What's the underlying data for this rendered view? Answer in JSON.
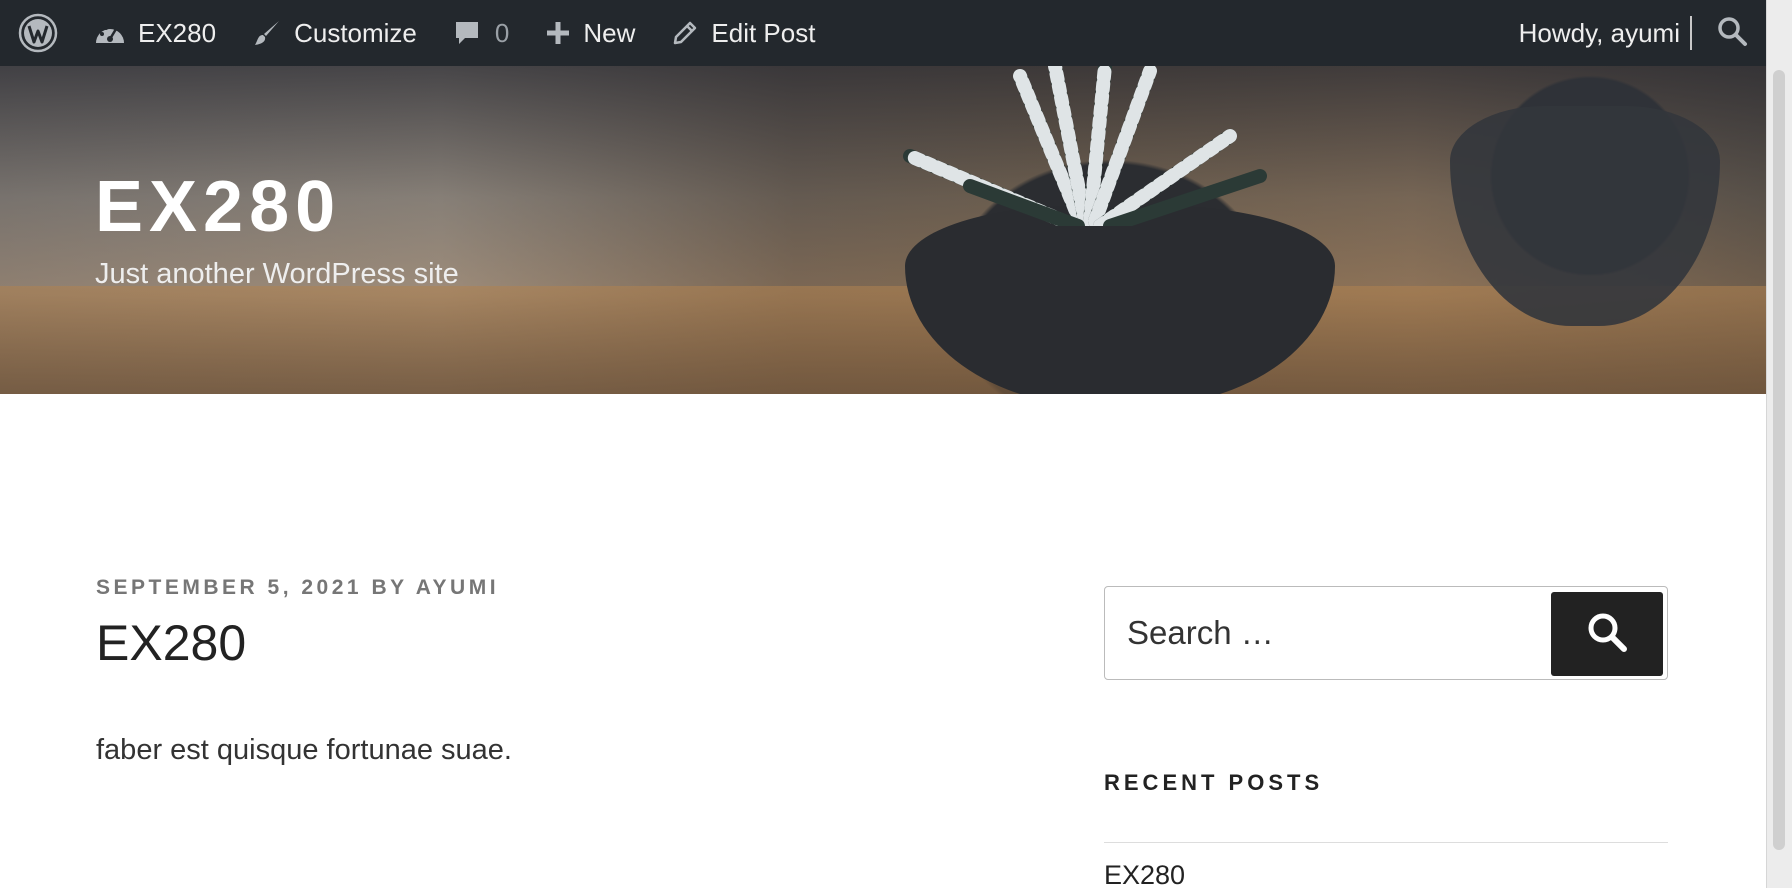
{
  "admin_bar": {
    "site_name": "EX280",
    "customize_label": "Customize",
    "comments_count": "0",
    "new_label": "New",
    "edit_post_label": "Edit Post",
    "howdy_text": "Howdy, ayumi",
    "icons": [
      "wordpress-logo-icon",
      "dashboard-icon",
      "brush-icon",
      "comment-icon",
      "plus-icon",
      "pencil-icon",
      "search-icon"
    ]
  },
  "header": {
    "site_title": "EX280",
    "site_description": "Just another WordPress site"
  },
  "post": {
    "date": "SEPTEMBER 5, 2021",
    "by": "BY",
    "author": "AYUMI",
    "title": "EX280",
    "content": "faber est quisque fortunae suae."
  },
  "sidebar": {
    "search_placeholder": "Search …",
    "recent_posts_title": "RECENT POSTS",
    "recent_posts": [
      "EX280"
    ]
  },
  "colors": {
    "admin_bar_bg": "#23282d",
    "search_button_bg": "#222222",
    "meta_text": "#767676"
  }
}
